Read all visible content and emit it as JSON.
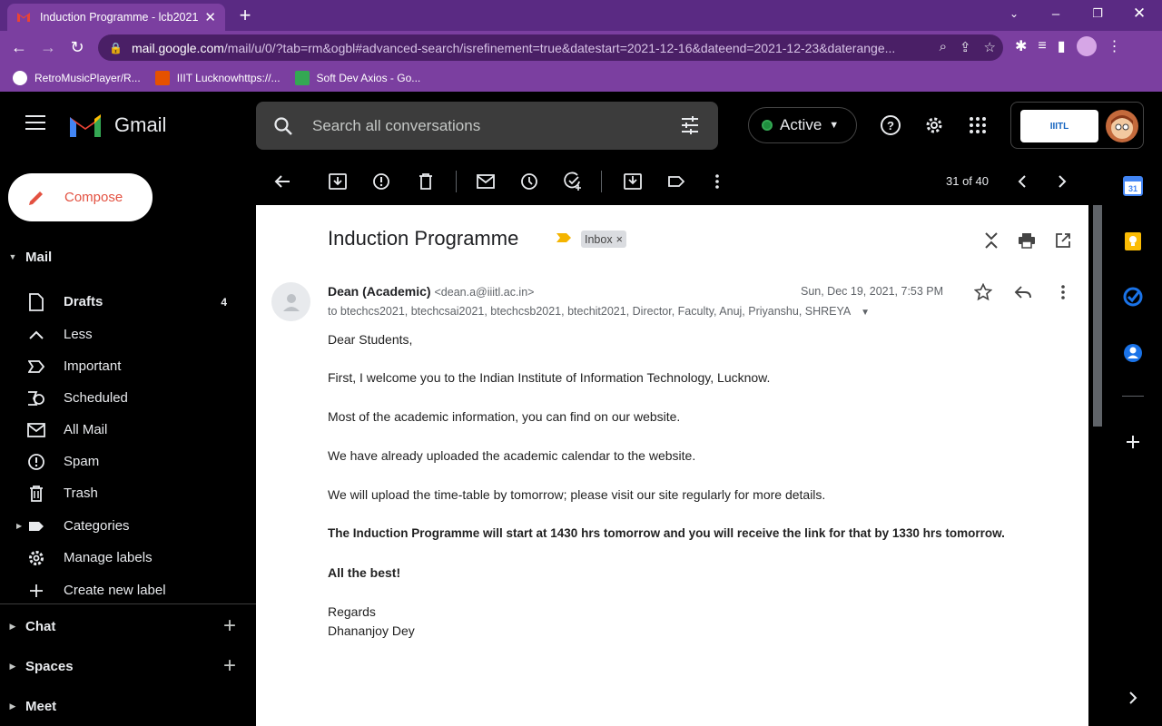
{
  "browser": {
    "tab_title": "Induction Programme - lcb2021",
    "url_host": "mail.google.com",
    "url_path": "/mail/u/0/?tab=rm&ogbl#advanced-search/isrefinement=true&datestart=2021-12-16&dateend=2021-12-23&daterange...",
    "bookmarks": [
      "RetroMusicPlayer/R...",
      "IIIT Lucknowhttps://...",
      "Soft Dev Axios - Go..."
    ]
  },
  "header": {
    "app_name": "Gmail",
    "search_placeholder": "Search all conversations",
    "status": "Active",
    "org_logo": "IIITL"
  },
  "sidebar": {
    "compose": "Compose",
    "mail_section": "Mail",
    "items": [
      {
        "label": "Drafts",
        "count": "4",
        "icon": "draft-icon"
      },
      {
        "label": "Less",
        "icon": "chevron-up-icon"
      },
      {
        "label": "Important",
        "icon": "important-icon"
      },
      {
        "label": "Scheduled",
        "icon": "scheduled-icon"
      },
      {
        "label": "All Mail",
        "icon": "all-mail-icon"
      },
      {
        "label": "Spam",
        "icon": "spam-icon"
      },
      {
        "label": "Trash",
        "icon": "trash-icon"
      },
      {
        "label": "Categories",
        "icon": "label-icon"
      },
      {
        "label": "Manage labels",
        "icon": "gear-icon"
      },
      {
        "label": "Create new label",
        "icon": "plus-icon"
      }
    ],
    "chat": "Chat",
    "spaces": "Spaces",
    "meet": "Meet"
  },
  "toolbar": {
    "pager": "31 of 40"
  },
  "message": {
    "subject": "Induction Programme",
    "label_chip": "Inbox",
    "label_chip_close": "×",
    "sender_name": "Dean (Academic)",
    "sender_email": "<dean.a@iiitl.ac.in>",
    "date": "Sun, Dec 19, 2021, 7:53 PM",
    "to": "to btechcs2021, btechcsai2021, btechcsb2021, btechit2021, Director, Faculty, Anuj, Priyanshu, SHREYA",
    "body": {
      "greeting": "Dear Students,",
      "p1": "First, I welcome you to the Indian Institute of Information Technology, Lucknow.",
      "p2": "Most of the academic information, you can find on our website.",
      "p3": "We have already uploaded the academic calendar to the website.",
      "p4": "We will upload the time-table by tomorrow; please visit our site regularly for more details.",
      "p5": "The Induction Programme will start at 1430 hrs tomorrow and you will receive the link for that by 1330 hrs tomorrow.",
      "p6": "All the best!",
      "regards": "Regards",
      "signature": "Dhananjoy Dey"
    }
  },
  "colors": {
    "chrome_purple": "#7b3fa0",
    "compose_red": "#e35141",
    "active_green": "#34a853",
    "important_yellow": "#f4b400"
  }
}
